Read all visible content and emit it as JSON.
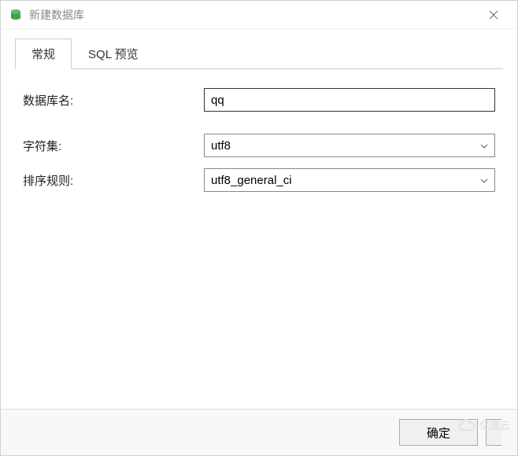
{
  "window": {
    "title": "新建数据库"
  },
  "tabs": [
    {
      "label": "常规",
      "active": true
    },
    {
      "label": "SQL 预览",
      "active": false
    }
  ],
  "form": {
    "db_name_label": "数据库名:",
    "db_name_value": "qq",
    "charset_label": "字符集:",
    "charset_value": "utf8",
    "collation_label": "排序规则:",
    "collation_value": "utf8_general_ci"
  },
  "buttons": {
    "ok": "确定"
  },
  "watermark": "亿速云"
}
